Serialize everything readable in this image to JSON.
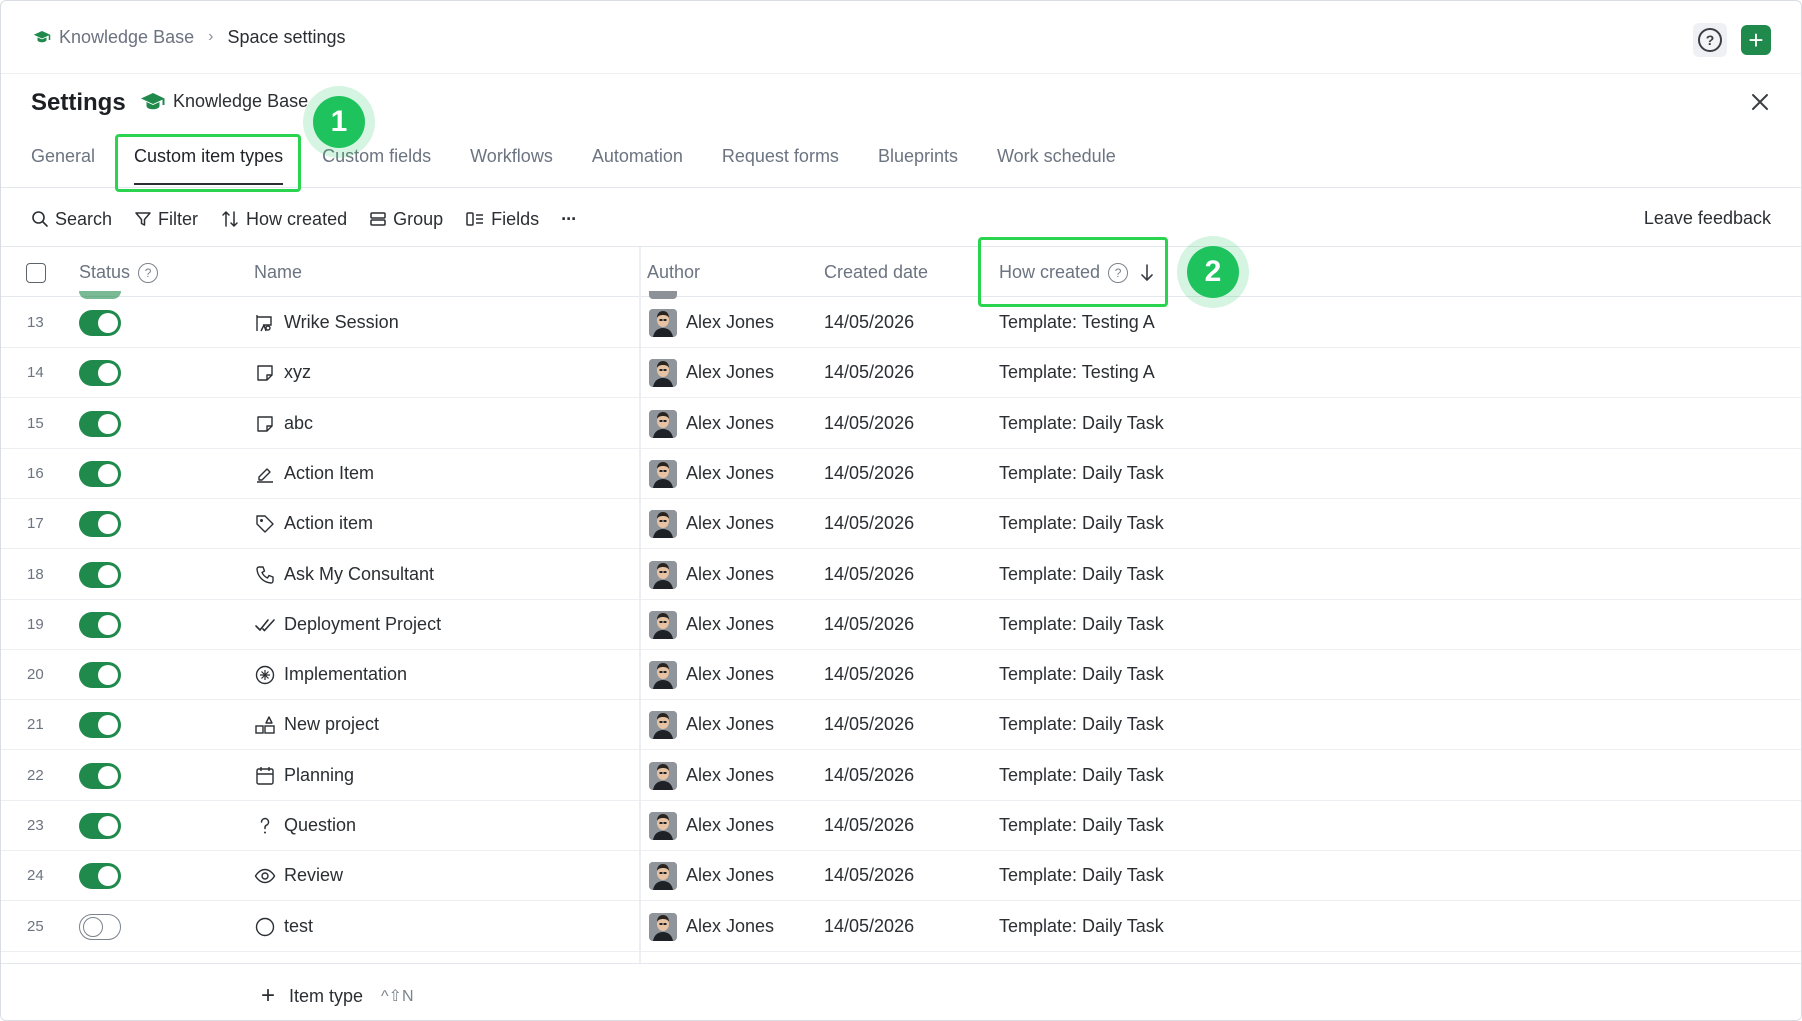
{
  "breadcrumb": {
    "space": "Knowledge Base",
    "separator": "›",
    "current": "Space settings"
  },
  "topbar": {
    "help_label": "?",
    "add_label": "+"
  },
  "settings": {
    "title": "Settings",
    "space_name": "Knowledge Base",
    "close_label": "×"
  },
  "callouts": {
    "one": "1",
    "two": "2"
  },
  "tabs": [
    {
      "label": "General"
    },
    {
      "label": "Custom item types"
    },
    {
      "label": "Custom fields"
    },
    {
      "label": "Workflows"
    },
    {
      "label": "Automation"
    },
    {
      "label": "Request forms"
    },
    {
      "label": "Blueprints"
    },
    {
      "label": "Work schedule"
    }
  ],
  "toolbar": {
    "search": "Search",
    "filter": "Filter",
    "sort": "How created",
    "group": "Group",
    "fields": "Fields",
    "more": "···",
    "feedback": "Leave feedback"
  },
  "table": {
    "columns": {
      "status": "Status",
      "name": "Name",
      "author": "Author",
      "created": "Created date",
      "how": "How created"
    },
    "rows": [
      {
        "num": "13",
        "enabled": true,
        "icon": "session-icon",
        "name": "Wrike Session",
        "author": "Alex Jones",
        "date": "14/05/2026",
        "how": "Template: Testing A"
      },
      {
        "num": "14",
        "enabled": true,
        "icon": "note-icon",
        "name": "xyz",
        "author": "Alex Jones",
        "date": "14/05/2026",
        "how": "Template: Testing A"
      },
      {
        "num": "15",
        "enabled": true,
        "icon": "note-icon",
        "name": "abc",
        "author": "Alex Jones",
        "date": "14/05/2026",
        "how": "Template: Daily Task"
      },
      {
        "num": "16",
        "enabled": true,
        "icon": "sign-icon",
        "name": "Action Item",
        "author": "Alex Jones",
        "date": "14/05/2026",
        "how": "Template: Daily Task"
      },
      {
        "num": "17",
        "enabled": true,
        "icon": "tag-icon",
        "name": "Action item",
        "author": "Alex Jones",
        "date": "14/05/2026",
        "how": "Template: Daily Task"
      },
      {
        "num": "18",
        "enabled": true,
        "icon": "phone-icon",
        "name": "Ask My Consultant",
        "author": "Alex Jones",
        "date": "14/05/2026",
        "how": "Template: Daily Task"
      },
      {
        "num": "19",
        "enabled": true,
        "icon": "check-icon",
        "name": "Deployment Project",
        "author": "Alex Jones",
        "date": "14/05/2026",
        "how": "Template: Daily Task"
      },
      {
        "num": "20",
        "enabled": true,
        "icon": "gear-circle-icon",
        "name": "Implementation",
        "author": "Alex Jones",
        "date": "14/05/2026",
        "how": "Template: Daily Task"
      },
      {
        "num": "21",
        "enabled": true,
        "icon": "shapes-icon",
        "name": "New project",
        "author": "Alex Jones",
        "date": "14/05/2026",
        "how": "Template: Daily Task"
      },
      {
        "num": "22",
        "enabled": true,
        "icon": "calendar-icon",
        "name": "Planning",
        "author": "Alex Jones",
        "date": "14/05/2026",
        "how": "Template: Daily Task"
      },
      {
        "num": "23",
        "enabled": true,
        "icon": "question-icon",
        "name": "Question",
        "author": "Alex Jones",
        "date": "14/05/2026",
        "how": "Template: Daily Task"
      },
      {
        "num": "24",
        "enabled": true,
        "icon": "eye-icon",
        "name": "Review",
        "author": "Alex Jones",
        "date": "14/05/2026",
        "how": "Template: Daily Task"
      },
      {
        "num": "25",
        "enabled": false,
        "icon": "circle-icon",
        "name": "test",
        "author": "Alex Jones",
        "date": "14/05/2026",
        "how": "Template: Daily Task"
      }
    ]
  },
  "footer": {
    "add_label": "Item type",
    "shortcut": "^⇧N"
  },
  "colors": {
    "accent": "#1f8a4c",
    "callout": "#1ec35d",
    "highlight": "#2bd44f"
  }
}
